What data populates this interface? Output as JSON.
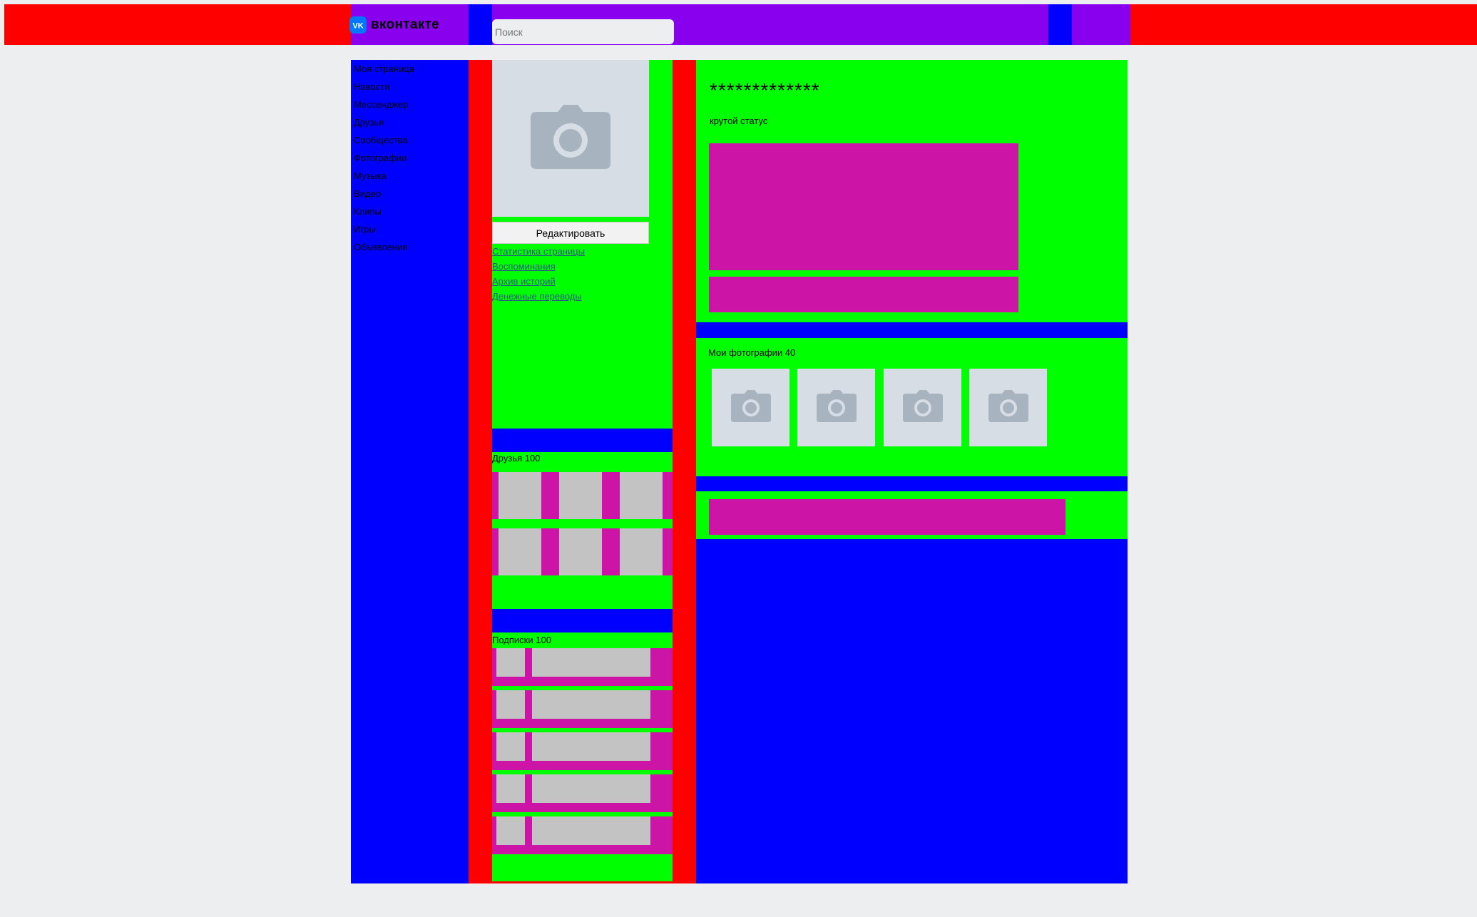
{
  "header": {
    "logo_text": "вконтакте",
    "search_placeholder": "Поиск"
  },
  "sidebar": {
    "items": [
      {
        "label": "Моя страница"
      },
      {
        "label": "Новости"
      },
      {
        "label": "Мессенджер"
      },
      {
        "label": "Друзья"
      },
      {
        "label": "Сообщества"
      },
      {
        "label": "Фотографии"
      },
      {
        "label": "Музыка"
      },
      {
        "label": "Видео"
      },
      {
        "label": "Клипы"
      },
      {
        "label": "Игры"
      },
      {
        "label": "Объявления"
      }
    ]
  },
  "profile": {
    "edit_button": "Редактировать",
    "links": [
      {
        "label": "Статистика страницы"
      },
      {
        "label": "Воспоминания"
      },
      {
        "label": "Архив историй"
      },
      {
        "label": "Денежные переводы"
      }
    ],
    "friends_title": "Друзья 100",
    "subscriptions_title": "Подписки 100"
  },
  "main": {
    "name": "*************",
    "status": "крутой статус",
    "photos_title": "Мои фотографии 40"
  },
  "colors": {
    "background": "#edeef0",
    "red": "#ff0000",
    "blue": "#0000ff",
    "green": "#00ff00",
    "purple": "#8800ee",
    "magenta": "#cc15a7",
    "placeholder_gray": "#c4c3c3",
    "photo_placeholder": "#d7dde5",
    "link": "#2a5885"
  },
  "icons": {
    "logo": "vk-logo-icon",
    "photo": "camera-icon"
  }
}
